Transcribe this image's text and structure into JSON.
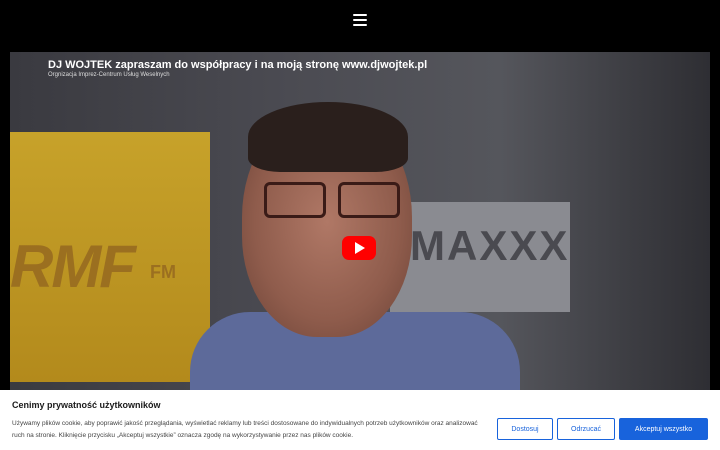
{
  "header": {
    "menu_icon": "hamburger-icon"
  },
  "video": {
    "title": "DJ WOJTEK zapraszam do współpracy i na moją stronę www.djwojtek.pl",
    "subtitle": "Orgnizacja Imprez-Centrum Usług Weselnych",
    "play_icon": "play-icon",
    "background_text_left": "RMF",
    "background_text_fm": "FM",
    "background_text_right": "MAXXX"
  },
  "cookie_banner": {
    "title": "Cenimy prywatność użytkowników",
    "text": "Używamy plików cookie, aby poprawić jakość przeglądania, wyświetlać reklamy lub treści dostosowane do indywidualnych potrzeb użytkowników oraz analizować ruch na stronie. Kliknięcie przycisku „Akceptuj wszystkie” oznacza zgodę na wykorzystywanie przez nas plików cookie.",
    "customize_label": "Dostosuj",
    "reject_label": "Odrzucać",
    "accept_label": "Akceptuj wszystko",
    "accent_color": "#1863dc"
  }
}
